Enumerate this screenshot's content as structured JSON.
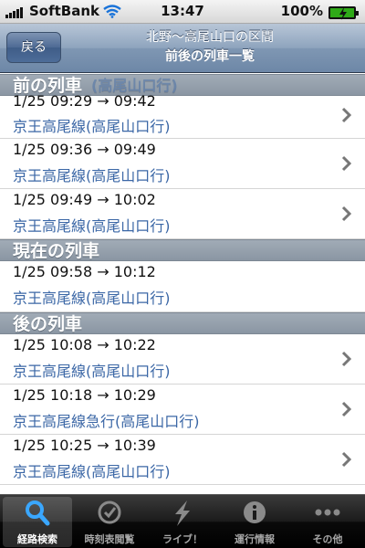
{
  "status_bar": {
    "carrier": "SoftBank",
    "time": "13:47",
    "battery": "100%"
  },
  "nav": {
    "back_label": "戻る",
    "title_line1": "北野～高尾山口の区間",
    "title_line2": "前後の列車一覧"
  },
  "sections": [
    {
      "header": "前の列車",
      "ghost_text": "(高尾山口行)",
      "rows": [
        {
          "time": "1/25 09:29 → 09:42",
          "line": "京王高尾線(高尾山口行)"
        },
        {
          "time": "1/25 09:36 → 09:49",
          "line": "京王高尾線(高尾山口行)"
        },
        {
          "time": "1/25 09:49 → 10:02",
          "line": "京王高尾線(高尾山口行)"
        }
      ]
    },
    {
      "header": "現在の列車",
      "rows": [
        {
          "time": "1/25 09:58 → 10:12",
          "line": "京王高尾線(高尾山口行)"
        }
      ]
    },
    {
      "header": "後の列車",
      "rows": [
        {
          "time": "1/25 10:08 → 10:22",
          "line": "京王高尾線(高尾山口行)"
        },
        {
          "time": "1/25 10:18 → 10:29",
          "line": "京王高尾線急行(高尾山口行)"
        },
        {
          "time": "1/25 10:25 → 10:39",
          "line": "京王高尾線(高尾山口行)"
        }
      ]
    }
  ],
  "tabs": [
    {
      "label": "経路検索",
      "icon": "search-icon",
      "active": true
    },
    {
      "label": "時刻表閲覧",
      "icon": "clock-icon",
      "active": false
    },
    {
      "label": "ライブ！",
      "icon": "lightning-icon",
      "active": false
    },
    {
      "label": "運行情報",
      "icon": "info-icon",
      "active": false
    },
    {
      "label": "その他",
      "icon": "more-icon",
      "active": false
    }
  ],
  "colors": {
    "line_text": "#3b67a6",
    "section_header": "#8a96a3",
    "nav_bar": "#6d87a7",
    "tab_active_label": "#ffffff"
  }
}
